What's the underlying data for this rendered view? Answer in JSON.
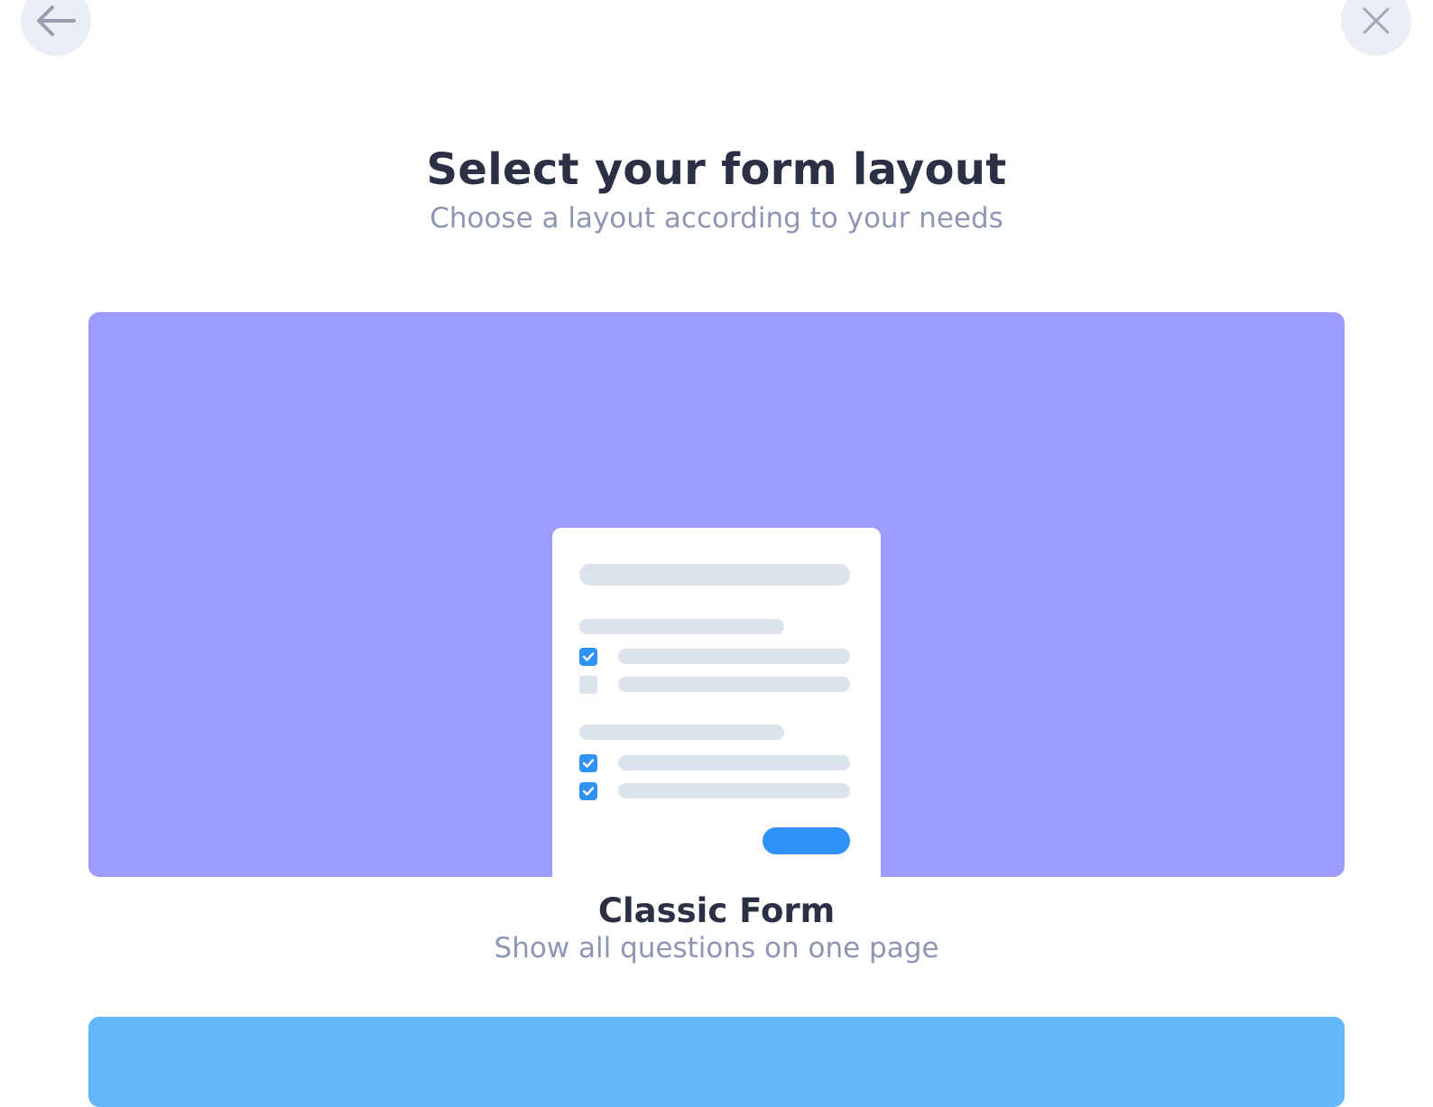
{
  "nav": {
    "back_icon": "arrow-left-icon",
    "close_icon": "close-icon"
  },
  "header": {
    "title": "Select your form layout",
    "subtitle": "Choose a layout according to your needs"
  },
  "layouts": [
    {
      "name": "Classic Form",
      "description": "Show all questions on one page",
      "preview_bg": "#9d9bfd",
      "preview_icon": "classic-form-preview-icon"
    },
    {
      "name": "",
      "description": "",
      "preview_bg": "#63b8fc"
    }
  ],
  "colors": {
    "accent": "#2e92f7",
    "title_text": "#2b3044",
    "muted_text": "#8f96b3",
    "icon_button_bg": "#eceef5",
    "placeholder_line": "#dde3ed"
  }
}
